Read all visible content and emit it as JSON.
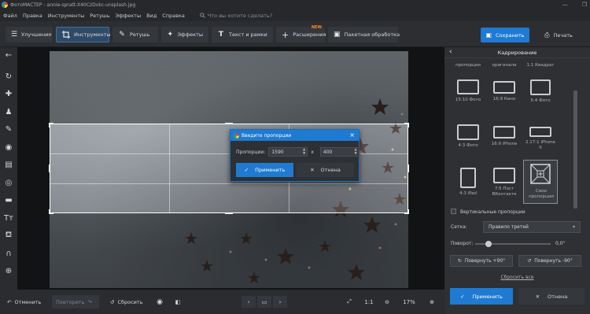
{
  "window": {
    "title": "ФотоМАСТЕР - annie-spratt-X40CzDvkc-unsplash.jpg",
    "minimize": "—",
    "maximize": "❐"
  },
  "menu": {
    "items": [
      "Файл",
      "Правка",
      "Инструменты",
      "Ретушь",
      "Эффекты",
      "Вид",
      "Справка"
    ],
    "search_placeholder": "Что вы хотите сделать?"
  },
  "toolbar": {
    "improve": "Улучшения",
    "tools": "Инструменты",
    "retouch": "Ретушь",
    "effects": "Эффекты",
    "text": "Текст и рамки",
    "extensions": "Расширения",
    "extensions_badge": "NEW",
    "batch": "Пакетная обработка",
    "save": "Сохранить",
    "print": "Печать"
  },
  "dialog": {
    "title": "Введите пропорции",
    "proportions_label": "Пропорции:",
    "width_value": "1590",
    "separator": "x",
    "height_value": "400",
    "apply": "Применить",
    "cancel": "Отнена"
  },
  "bottom": {
    "undo": "Отменить",
    "redo": "Повторить",
    "reset": "Сбросить",
    "ratio_1_1": "1:1",
    "zoom": "17%"
  },
  "panel": {
    "title": "Кадрирование",
    "tiles_top_labels": [
      "пропорции",
      "оригинала",
      "1:1 Квадрат"
    ],
    "tiles": [
      {
        "label": "15:10 Фото"
      },
      {
        "label": "16:9 Кино"
      },
      {
        "label": "5:4 Фото"
      },
      {
        "label": "4:3 Фото"
      },
      {
        "label": "16:9 iPhone"
      },
      {
        "label": "2.17:1 iPhone X"
      },
      {
        "label": "4:3 iPad"
      },
      {
        "label": "7:5 Пост ВКонтакте"
      },
      {
        "label": "Свои пропорции"
      }
    ],
    "vertical_label": "Вертикальные пропорции",
    "grid_label": "Сетка:",
    "grid_value": "Правило третей",
    "rotation_label": "Поворот:",
    "rotation_value": "0,0°",
    "rotate_plus": "Повернуть +90°",
    "rotate_minus": "Повернуть -90°",
    "reset_all": "Сбросить все",
    "apply": "Применить",
    "cancel": "Отнена"
  },
  "colors": {
    "accent": "#1f7ad1",
    "background": "#1e1f22",
    "badge": "#ff8a1f"
  }
}
